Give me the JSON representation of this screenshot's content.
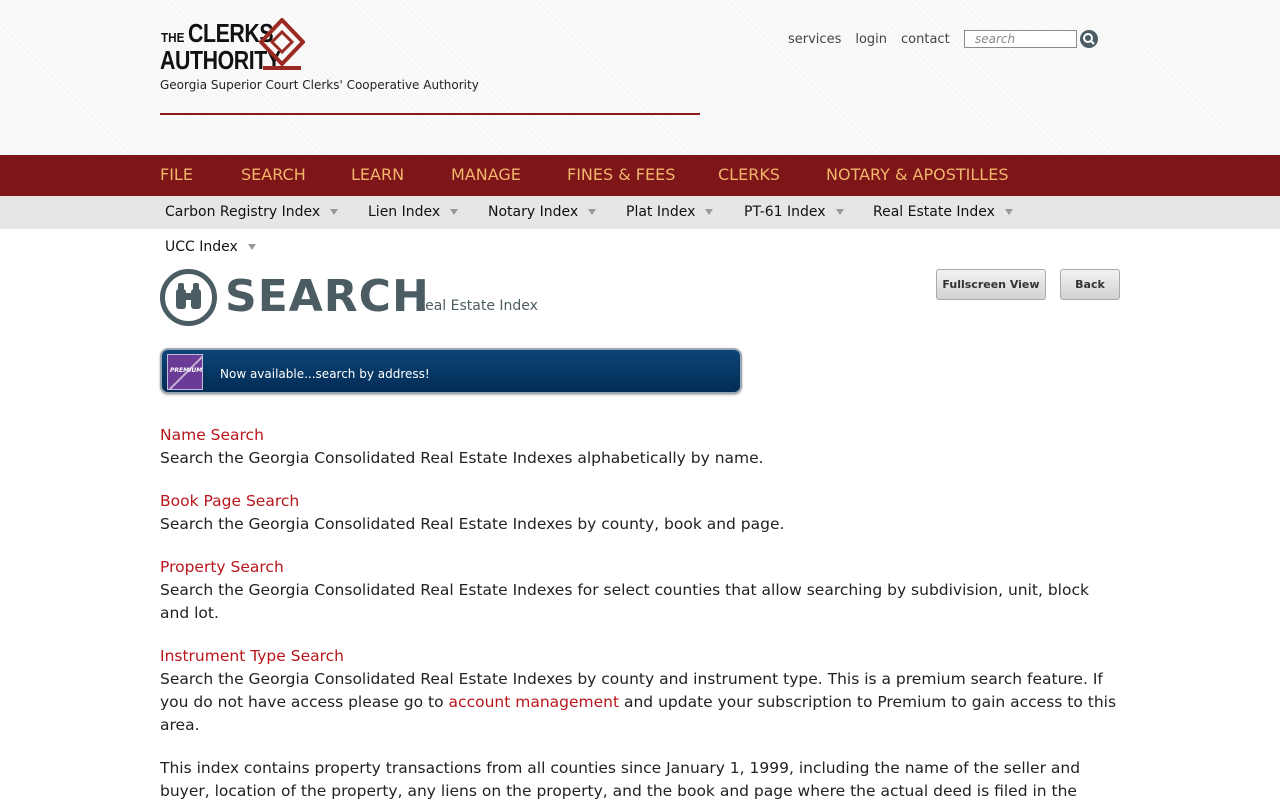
{
  "header": {
    "logo": {
      "the": "THE",
      "clerks": "CLERKS",
      "authority": "AUTHORITY"
    },
    "tagline": "Georgia Superior Court Clerks' Cooperative Authority",
    "top_links": [
      "services",
      "login",
      "contact"
    ],
    "search_placeholder": "search"
  },
  "main_nav": [
    "FILE",
    "SEARCH",
    "LEARN",
    "MANAGE",
    "FINES & FEES",
    "CLERKS",
    "NOTARY & APOSTILLES"
  ],
  "sub_nav": [
    "Carbon Registry Index",
    "Lien Index",
    "Notary Index",
    "Plat Index",
    "PT-61 Index",
    "Real Estate Index",
    "UCC Index"
  ],
  "page": {
    "title": "SEARCH",
    "subtitle": "Real Estate Index",
    "fullscreen_button": "Fullscreen View",
    "back_button": "Back"
  },
  "banner": {
    "badge": "PREMIUM",
    "text": "Now available...search by address!"
  },
  "sections": [
    {
      "title": "Name Search",
      "desc": "Search the Georgia Consolidated Real Estate Indexes alphabetically by name."
    },
    {
      "title": "Book Page Search",
      "desc": "Search the Georgia Consolidated Real Estate Indexes by county, book and page."
    },
    {
      "title": "Property Search",
      "desc": "Search the Georgia Consolidated Real Estate Indexes for select counties that allow searching by subdivision, unit, block and lot."
    },
    {
      "title": "Instrument Type Search",
      "desc_before": "Search the Georgia Consolidated Real Estate Indexes by county and instrument type. This is a premium search feature. If you do not have access please go to ",
      "desc_link": "account management",
      "desc_after": " and update your subscription to Premium to gain access to this area."
    }
  ],
  "footer_text": "This index contains property transactions from all counties since January 1, 1999, including the name of the seller and buyer, location of the property, any liens on the property, and the book and page where the actual deed is filed in the",
  "colors": {
    "brand_red": "#7e1519",
    "nav_text": "#f0b66a",
    "link_red": "#b8161c",
    "slate": "#4b5d63"
  },
  "icons": [
    "logo-diamond-mark",
    "search-icon",
    "binoculars-icon",
    "premium-badge-icon"
  ]
}
